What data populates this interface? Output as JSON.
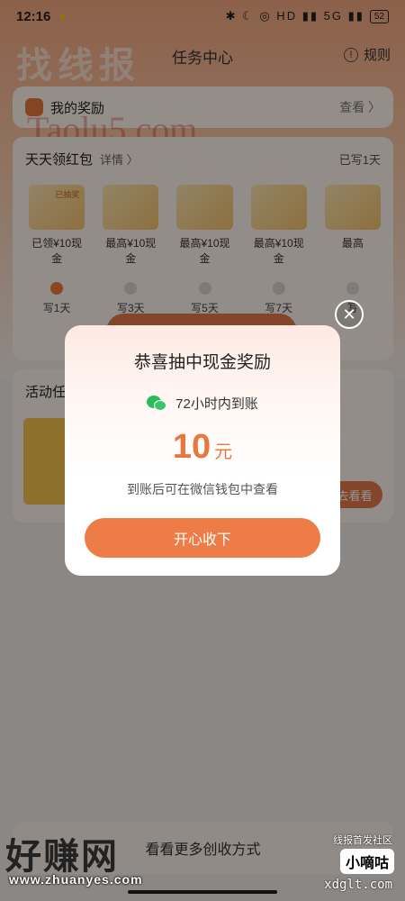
{
  "status": {
    "time": "12:16",
    "icons": "✱ ☾ ◎ HD ▮▮ 5G ▮▮",
    "battery": "52"
  },
  "header": {
    "watermark": "找线报",
    "title": "任务中心",
    "rules_label": "规则"
  },
  "reward_card": {
    "title": "我的奖励",
    "link": "查看 〉"
  },
  "site_watermark": "Taolu5.com",
  "redpack": {
    "title": "天天领红包",
    "detail": "详情 〉",
    "written": "已写1天",
    "prizes": [
      {
        "tag": "已抽奖",
        "label": "已领¥10现金"
      },
      {
        "tag": "",
        "label": "最高¥10现金"
      },
      {
        "tag": "",
        "label": "最高¥10现金"
      },
      {
        "tag": "",
        "label": "最高¥10现金"
      },
      {
        "tag": "",
        "label": "最高"
      }
    ],
    "steps": [
      "写1天",
      "写3天",
      "写5天",
      "写7天",
      "写"
    ]
  },
  "tasks": {
    "title": "活动任",
    "button": "去看看"
  },
  "bottom_bar": {
    "text": "看看更多创收方式"
  },
  "watermarks": {
    "left_big": "好赚网",
    "left_url": "www.zhuanyes.com",
    "right_top": "线报首发社区",
    "right_badge": "小嘀咕",
    "right_url": "xdglt.com"
  },
  "modal": {
    "title": "恭喜抽中现金奖励",
    "wechat_text": "72小时内到账",
    "amount": "10",
    "unit": "元",
    "note": "到账后可在微信钱包中查看",
    "button": "开心收下",
    "close": "✕"
  },
  "colors": {
    "accent": "#ee7c47",
    "wechat": "#2dbb5a"
  }
}
